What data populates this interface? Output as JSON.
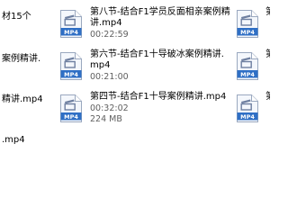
{
  "icon_name": "mp4-video-file-icon",
  "icon_badge": "MP4",
  "colors": {
    "badge_blue": "#2f6fc5",
    "page_fill": "#f4f7fc",
    "page_border": "#9aa8bf",
    "glyph": "#6e7fa0",
    "meta_text": "#5f5f5f"
  },
  "left_column": [
    {
      "text": "材15个"
    },
    {
      "text": "案例精讲."
    },
    {
      "text": "精讲.mp4"
    },
    {
      "text": ".mp4"
    }
  ],
  "files": [
    {
      "title_line1": "第八节-结合F1学员反面相亲案例精",
      "title_line2": "讲.mp4",
      "duration": "00:22:59",
      "size": ""
    },
    {
      "title_line1": "第六节-结合F1十导破冰案例精讲.",
      "title_line2": "mp4",
      "duration": "00:21:00",
      "size": ""
    },
    {
      "title_line1": "第四节-结合F1十导案例精讲.mp4",
      "title_line2": "",
      "duration": "00:32:02",
      "size": "224 MB"
    }
  ],
  "right_column": [
    {
      "text": "第"
    },
    {
      "text": "第"
    },
    {
      "text": "第"
    }
  ]
}
